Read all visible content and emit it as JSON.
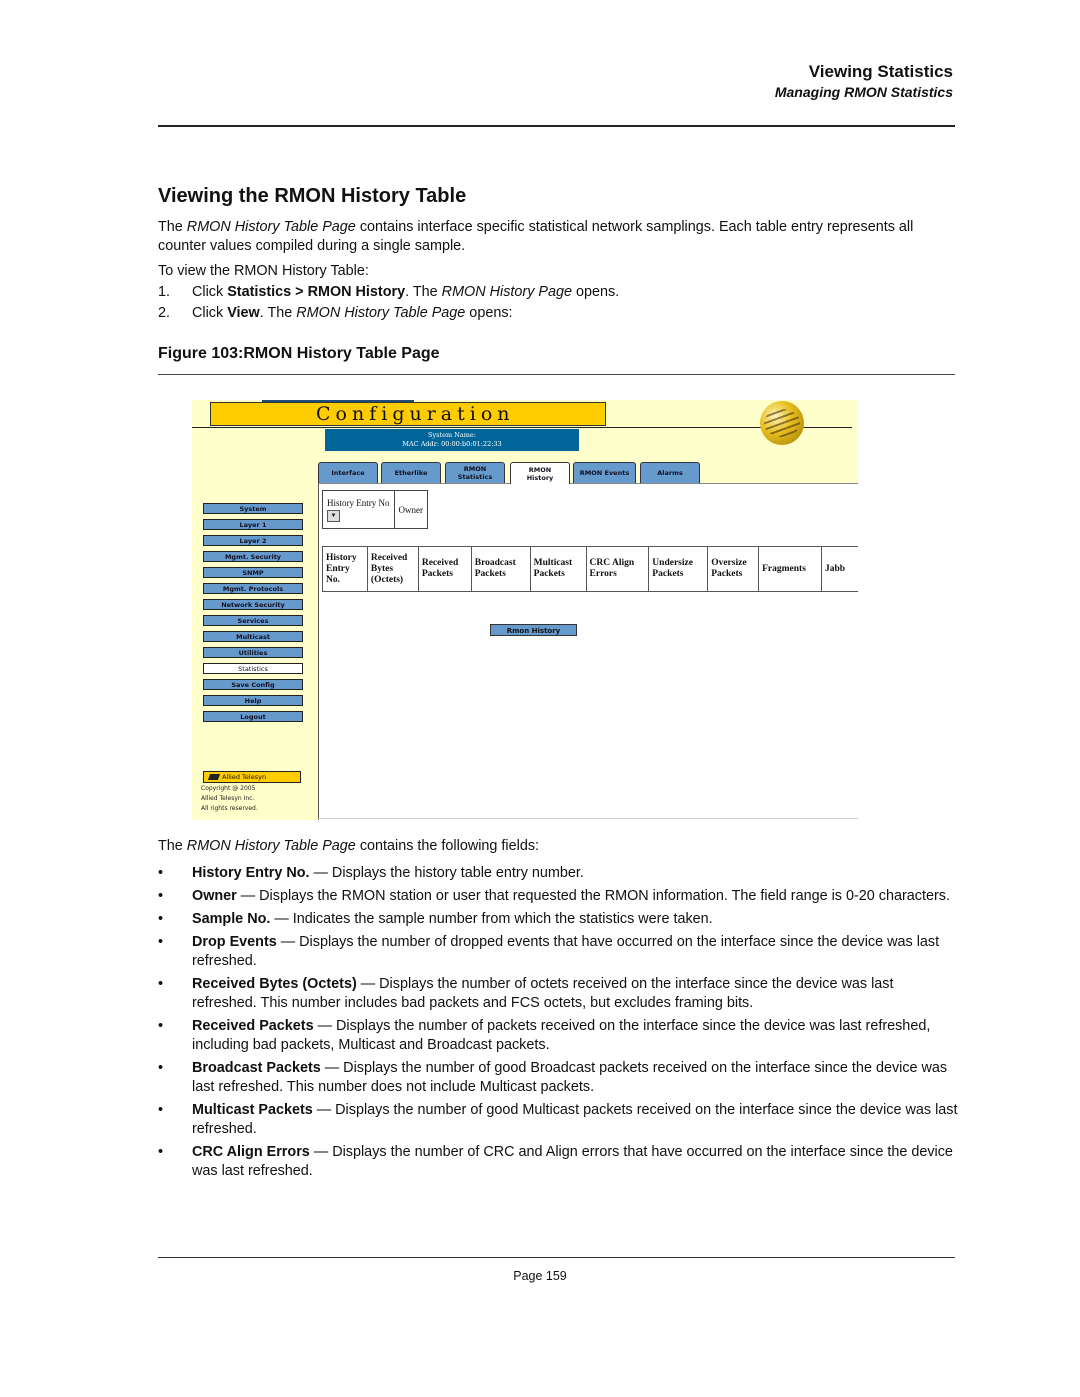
{
  "header": {
    "section": "Viewing Statistics",
    "subsection": "Managing RMON Statistics"
  },
  "heading": "Viewing the RMON History Table",
  "intro": {
    "pre": "The ",
    "italic": "RMON History Table Page",
    "post": " contains interface specific statistical network samplings. Each table entry represents all counter values compiled during a single sample."
  },
  "to_view": "To view the RMON History Table:",
  "steps": [
    {
      "num": "1.",
      "pre": "Click ",
      "bold": "Statistics > RMON History",
      "mid": ". The ",
      "italic": "RMON History Page",
      "post": " opens."
    },
    {
      "num": "2.",
      "pre": "Click ",
      "bold": "View",
      "mid": ". The ",
      "italic": "RMON History Table Page",
      "post": " opens:"
    }
  ],
  "figure_caption": "Figure 103:RMON History Table Page",
  "screenshot": {
    "banner_title": "Configuration",
    "system_name_label": "System Name:",
    "mac_label": "MAC Addr:  00:00:b0:01:22:33",
    "tabs": [
      {
        "label": "Interface",
        "active": false
      },
      {
        "label": "Etherlike",
        "active": false
      },
      {
        "label": "RMON Statistics",
        "active": false
      },
      {
        "label": "RMON History",
        "active": true
      },
      {
        "label": "RMON Events",
        "active": false
      },
      {
        "label": "Alarms",
        "active": false
      }
    ],
    "selector": {
      "history_entry_label": "History Entry No",
      "dropdown_glyph": "▼",
      "owner_label": "Owner"
    },
    "table_columns": [
      "History Entry No.",
      "Received Bytes (Octets)",
      "Received Packets",
      "Broadcast Packets",
      "Multicast Packets",
      "CRC Align Errors",
      "Undersize Packets",
      "Oversize Packets",
      "Fragments",
      "Jabb"
    ],
    "rmon_history_button": "Rmon History",
    "menu": [
      {
        "label": "System",
        "active": false
      },
      {
        "label": "Layer 1",
        "active": false
      },
      {
        "label": "Layer 2",
        "active": false
      },
      {
        "label": "Mgmt. Security",
        "active": false
      },
      {
        "label": "SNMP",
        "active": false
      },
      {
        "label": "Mgmt. Protocols",
        "active": false
      },
      {
        "label": "Network Security",
        "active": false
      },
      {
        "label": "Services",
        "active": false
      },
      {
        "label": "Multicast",
        "active": false
      },
      {
        "label": "Utilities",
        "active": false
      },
      {
        "label": "Statistics",
        "active": true
      },
      {
        "label": "Save Config",
        "active": false
      },
      {
        "label": "Help",
        "active": false
      },
      {
        "label": "Logout",
        "active": false
      }
    ],
    "logo_text": "Allied Telesyn",
    "copyright": [
      "Copyright @ 2005",
      "Allied Telesyn Inc.",
      "All rights reserved."
    ]
  },
  "fields_intro": {
    "pre": "The ",
    "italic": "RMON History Table Page",
    "post": " contains the following fields:"
  },
  "fields": [
    {
      "term": "History Entry No.",
      "desc": " — Displays the history table entry number."
    },
    {
      "term": "Owner",
      "desc": " — Displays the RMON station or user that requested the RMON information. The field range is 0-20 characters."
    },
    {
      "term": "Sample No.",
      "desc": " — Indicates the sample number from which the statistics were taken."
    },
    {
      "term": "Drop Events",
      "desc": " — Displays the number of dropped events that have occurred on the interface since the device was last refreshed."
    },
    {
      "term": "Received Bytes (Octets)",
      "desc": " — Displays the number of octets received on the interface since the device was last refreshed. This number includes bad packets and FCS octets, but excludes framing bits."
    },
    {
      "term": "Received Packets",
      "desc": " — Displays the number of packets received on the interface since the device was last refreshed, including bad packets, Multicast and Broadcast packets."
    },
    {
      "term": "Broadcast Packets",
      "desc": " — Displays the number of good Broadcast packets received on the interface since the device was last refreshed. This number does not include Multicast packets."
    },
    {
      "term": "Multicast Packets",
      "desc": " — Displays the number of good Multicast packets received on the interface since the device was last refreshed."
    },
    {
      "term": "CRC Align Errors",
      "desc": " — Displays the number of CRC and Align errors that have occurred on the interface since the device was last refreshed."
    }
  ],
  "footer": {
    "page": "Page 159"
  }
}
